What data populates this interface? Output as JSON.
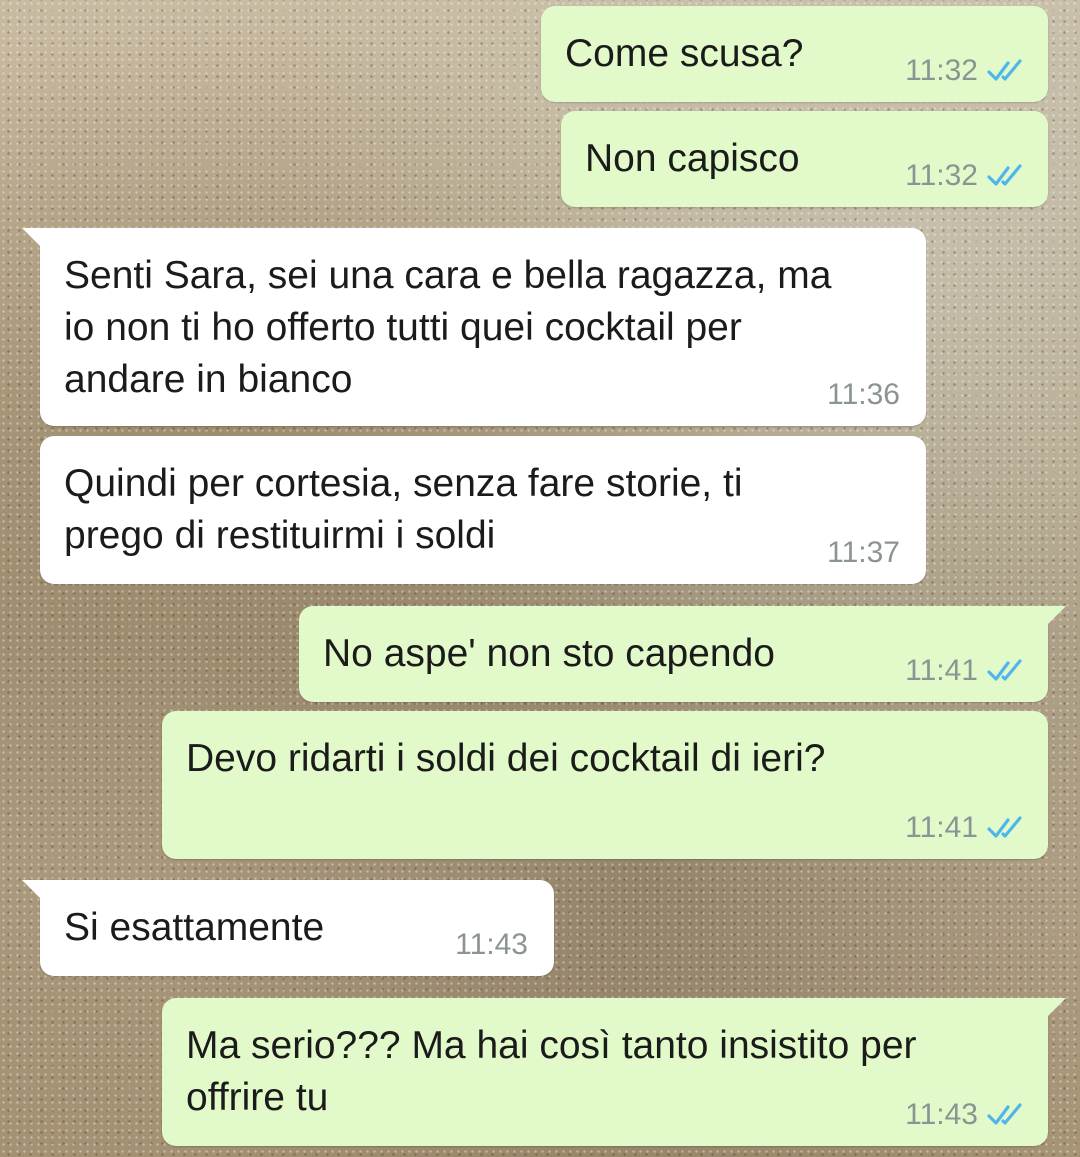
{
  "colors": {
    "outgoing_bubble": "#e2fac9",
    "incoming_bubble": "#ffffff",
    "read_ticks": "#4fb6ec",
    "timestamp": "#8a9492"
  },
  "messages": [
    {
      "direction": "outgoing",
      "text": "Come scusa?",
      "time": "11:32",
      "status_icon": "double-check-read-icon"
    },
    {
      "direction": "outgoing",
      "text": "Non capisco",
      "time": "11:32",
      "status_icon": "double-check-read-icon"
    },
    {
      "direction": "incoming",
      "text": "Senti Sara, sei una cara e bella ragazza, ma\nio non ti ho offerto tutti quei cocktail per\nandare in bianco",
      "time": "11:36"
    },
    {
      "direction": "incoming",
      "text": "Quindi per cortesia, senza fare storie, ti\nprego di restituirmi i soldi",
      "time": "11:37"
    },
    {
      "direction": "outgoing",
      "text": "No aspe' non sto capendo",
      "time": "11:41",
      "status_icon": "double-check-read-icon"
    },
    {
      "direction": "outgoing",
      "text": "Devo ridarti i soldi dei cocktail di ieri?",
      "time": "11:41",
      "status_icon": "double-check-read-icon"
    },
    {
      "direction": "incoming",
      "text": "Si esattamente",
      "time": "11:43"
    },
    {
      "direction": "outgoing",
      "text": "Ma serio??? Ma hai così tanto insistito per\noffrire tu",
      "time": "11:43",
      "status_icon": "double-check-read-icon"
    }
  ]
}
